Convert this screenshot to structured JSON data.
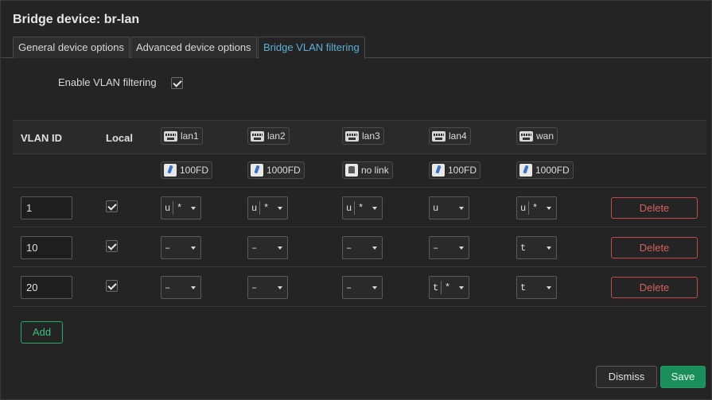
{
  "dialog": {
    "title": "Bridge device: br-lan",
    "tabs": [
      "General device options",
      "Advanced device options",
      "Bridge VLAN filtering"
    ],
    "active_tab": "Bridge VLAN filtering"
  },
  "enable_vlan": {
    "label": "Enable VLAN filtering",
    "checked": true
  },
  "table": {
    "headers": {
      "vlan_id": "VLAN ID",
      "local": "Local"
    },
    "ports": [
      {
        "name": "lan1",
        "icon": "network-port-icon",
        "status": "100FD",
        "status_icon": "cable-connected-icon"
      },
      {
        "name": "lan2",
        "icon": "network-port-icon",
        "status": "1000FD",
        "status_icon": "cable-connected-icon"
      },
      {
        "name": "lan3",
        "icon": "network-port-icon",
        "status": "no link",
        "status_icon": "no-link-icon"
      },
      {
        "name": "lan4",
        "icon": "network-port-icon",
        "status": "100FD",
        "status_icon": "cable-connected-icon"
      },
      {
        "name": "wan",
        "icon": "network-port-icon",
        "status": "1000FD",
        "status_icon": "cable-connected-icon"
      }
    ],
    "rows": [
      {
        "vlan_id": "1",
        "local": true,
        "cells": [
          [
            "u",
            "*"
          ],
          [
            "u",
            "*"
          ],
          [
            "u",
            "*"
          ],
          [
            "u",
            ""
          ],
          [
            "u",
            "*"
          ]
        ],
        "delete_label": "Delete"
      },
      {
        "vlan_id": "10",
        "local": true,
        "cells": [
          [
            "–",
            ""
          ],
          [
            "–",
            ""
          ],
          [
            "–",
            ""
          ],
          [
            "–",
            ""
          ],
          [
            "t",
            ""
          ]
        ],
        "delete_label": "Delete"
      },
      {
        "vlan_id": "20",
        "local": true,
        "cells": [
          [
            "–",
            ""
          ],
          [
            "–",
            ""
          ],
          [
            "–",
            ""
          ],
          [
            "t",
            "*"
          ],
          [
            "t",
            ""
          ]
        ],
        "delete_label": "Delete"
      }
    ]
  },
  "buttons": {
    "add": "Add",
    "dismiss": "Dismiss",
    "save": "Save"
  },
  "colors": {
    "accent_tab": "#5ab0d8",
    "delete": "#d76060",
    "add": "#3cc07e",
    "save_bg": "#1b8f5b"
  }
}
